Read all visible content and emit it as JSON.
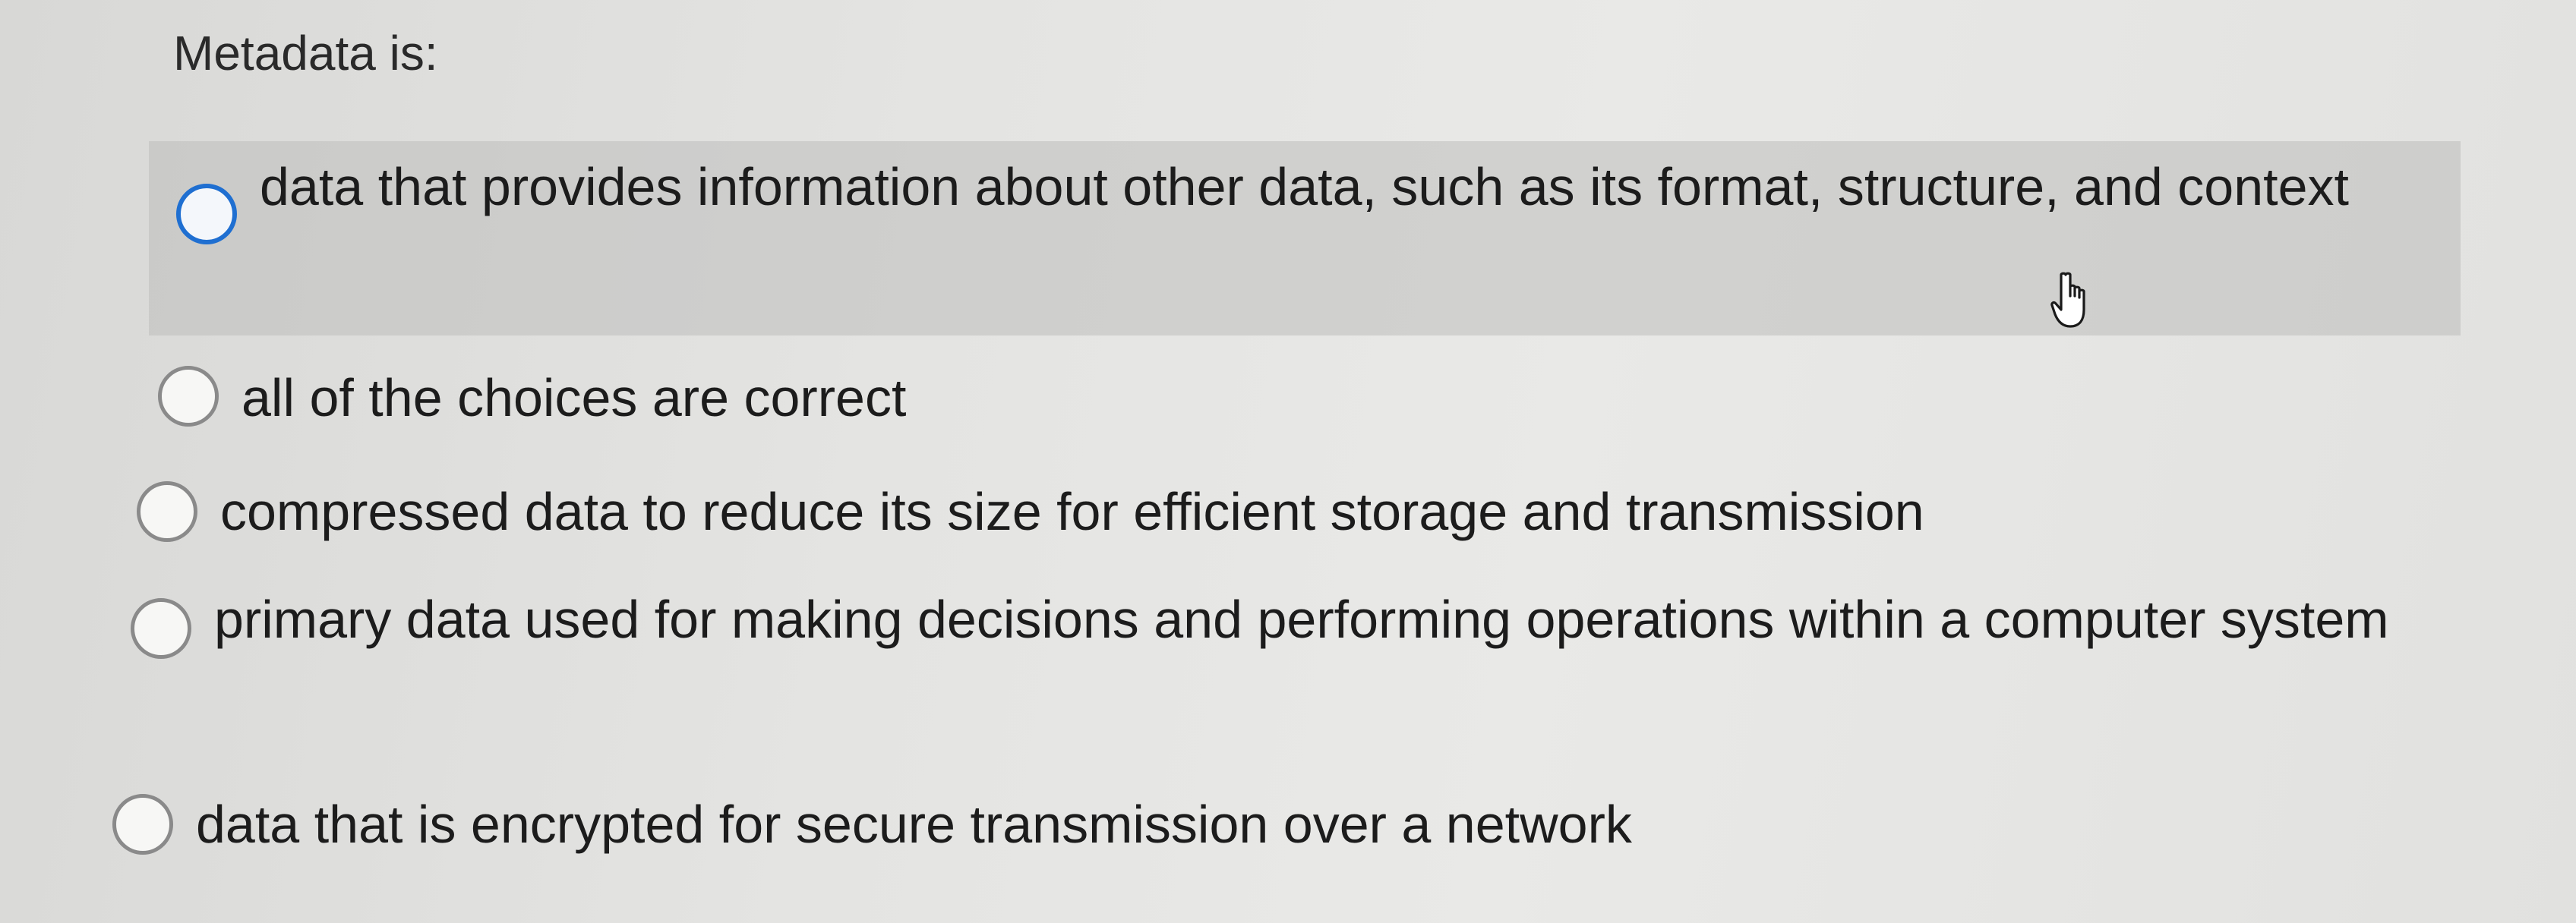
{
  "question": {
    "title": "Metadata is:"
  },
  "choices": [
    {
      "label": "data that provides information about other data, such as its format, structure, and context",
      "state": "hovered"
    },
    {
      "label": "all of the choices are correct",
      "state": "unselected"
    },
    {
      "label": "compressed data to reduce its size for efficient storage and transmission",
      "state": "unselected"
    },
    {
      "label": "primary data used for making decisions and performing operations within a computer system",
      "state": "unselected"
    },
    {
      "label": "data that is encrypted for secure transmission over a network",
      "state": "unselected"
    }
  ],
  "colors": {
    "focus_ring": "#1f6fd1",
    "hover_background": "#c8c8c6"
  },
  "cursor": {
    "icon": "hand-pointer-icon"
  }
}
